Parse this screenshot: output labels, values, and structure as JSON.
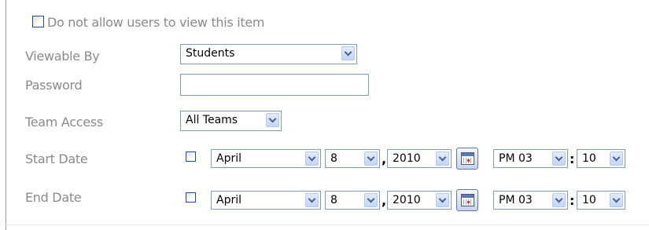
{
  "visibility": {
    "do_not_allow_label": "Do not allow users to view this item",
    "do_not_allow_checked": false
  },
  "fields": {
    "viewable_by": {
      "label": "Viewable By",
      "value": "Students"
    },
    "password": {
      "label": "Password",
      "value": ""
    },
    "team_access": {
      "label": "Team Access",
      "value": "All Teams"
    },
    "start_date": {
      "label": "Start Date",
      "enabled": false,
      "month": "April",
      "day": "8",
      "year": "2010",
      "hour": "PM 03",
      "minute": "10"
    },
    "end_date": {
      "label": "End Date",
      "enabled": false,
      "month": "April",
      "day": "8",
      "year": "2010",
      "hour": "PM 03",
      "minute": "10"
    }
  },
  "separators": {
    "comma": ",",
    "colon": ":"
  },
  "icons": {
    "calendar": "calendar-icon",
    "dropdown": "chevron-down-icon"
  },
  "colors": {
    "label_text": "#8a8a8a",
    "input_border": "#7f9db9",
    "checkbox_border": "#1f4f83"
  }
}
